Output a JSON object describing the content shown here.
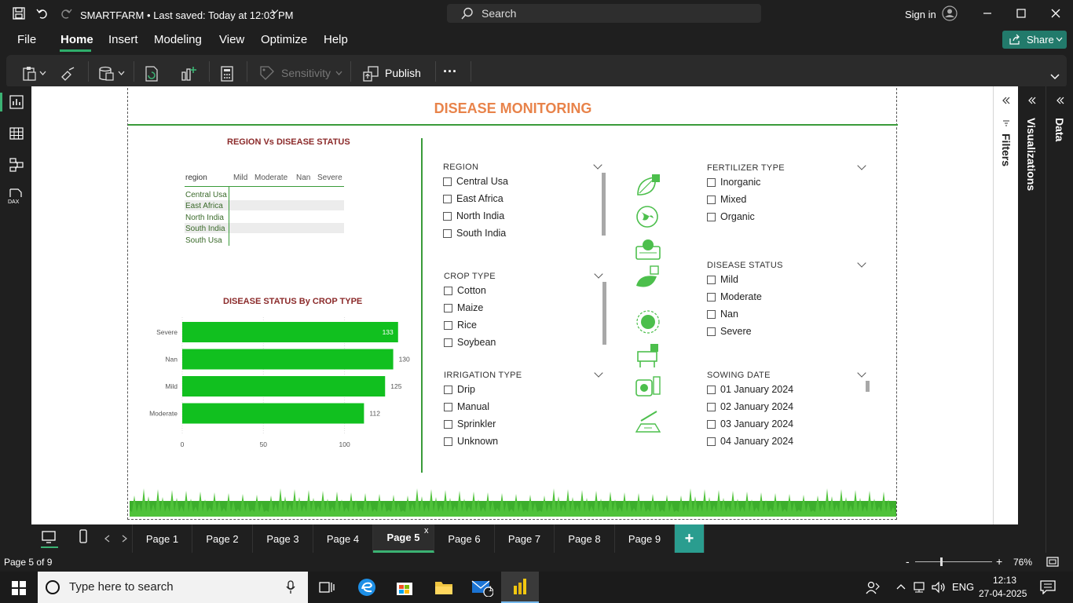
{
  "titlebar": {
    "app_title": "SMARTFARM",
    "save_status": "Last saved: Today at 12:03 PM",
    "search_placeholder": "Search",
    "sign_in": "Sign in"
  },
  "menu": {
    "items": [
      "File",
      "Home",
      "Insert",
      "Modeling",
      "View",
      "Optimize",
      "Help"
    ],
    "active": "Home",
    "share_label": "Share"
  },
  "ribbon": {
    "sensitivity_label": "Sensitivity",
    "publish_label": "Publish",
    "more_label": "···"
  },
  "report": {
    "title": "DISEASE MONITORING",
    "matrix": {
      "title": "REGION Vs DISEASE STATUS",
      "row_header": "region",
      "columns": [
        "Mild",
        "Moderate",
        "Nan",
        "Severe"
      ],
      "rows": [
        "Central Usa",
        "East Africa",
        "North India",
        "South India",
        "South Usa"
      ]
    },
    "bar_chart": {
      "title": "DISEASE STATUS By CROP TYPE"
    },
    "slicers": {
      "region": {
        "title": "REGION",
        "options": [
          "Central Usa",
          "East Africa",
          "North India",
          "South India"
        ]
      },
      "crop_type": {
        "title": "CROP TYPE",
        "options": [
          "Cotton",
          "Maize",
          "Rice",
          "Soybean"
        ]
      },
      "irrigation_type": {
        "title": "IRRIGATION TYPE",
        "options": [
          "Drip",
          "Manual",
          "Sprinkler",
          "Unknown"
        ]
      },
      "fertilizer_type": {
        "title": "FERTILIZER TYPE",
        "options": [
          "Inorganic",
          "Mixed",
          "Organic"
        ]
      },
      "disease_status": {
        "title": "DISEASE STATUS",
        "options": [
          "Mild",
          "Moderate",
          "Nan",
          "Severe"
        ]
      },
      "sowing_date": {
        "title": "SOWING DATE",
        "options": [
          "01 January 2024",
          "02 January 2024",
          "03 January 2024",
          "04 January 2024"
        ]
      }
    }
  },
  "chart_data": {
    "type": "bar",
    "orientation": "horizontal",
    "title": "DISEASE STATUS By CROP TYPE",
    "categories": [
      "Severe",
      "Nan",
      "Mild",
      "Moderate"
    ],
    "values": [
      133,
      130,
      125,
      112
    ],
    "x_ticks": [
      "0",
      "50",
      "100"
    ],
    "xlim": [
      0,
      130
    ],
    "bar_color": "#11c01f"
  },
  "side_panes": {
    "filters_label": "Filters",
    "visualizations_label": "Visualizations",
    "data_label": "Data"
  },
  "pages": {
    "tabs": [
      "Page 1",
      "Page 2",
      "Page 3",
      "Page 4",
      "Page 5",
      "Page 6",
      "Page 7",
      "Page 8",
      "Page 9"
    ],
    "active": "Page 5",
    "close_mark": "x",
    "add_label": "+"
  },
  "status": {
    "page_indicator": "Page 5 of 9",
    "zoom_minus": "-",
    "zoom_plus": "+",
    "zoom_level": "76%"
  },
  "taskbar": {
    "search_placeholder": "Type here to search",
    "language": "ENG",
    "time": "12:13",
    "date": "27-04-2025",
    "mail_badge": "1"
  },
  "colors": {
    "accent_green": "#3a9b3a",
    "title_orange": "#e8834a",
    "visual_title": "#8b2a2a",
    "share_button": "#227a6b",
    "add_page": "#2a9d8f"
  }
}
